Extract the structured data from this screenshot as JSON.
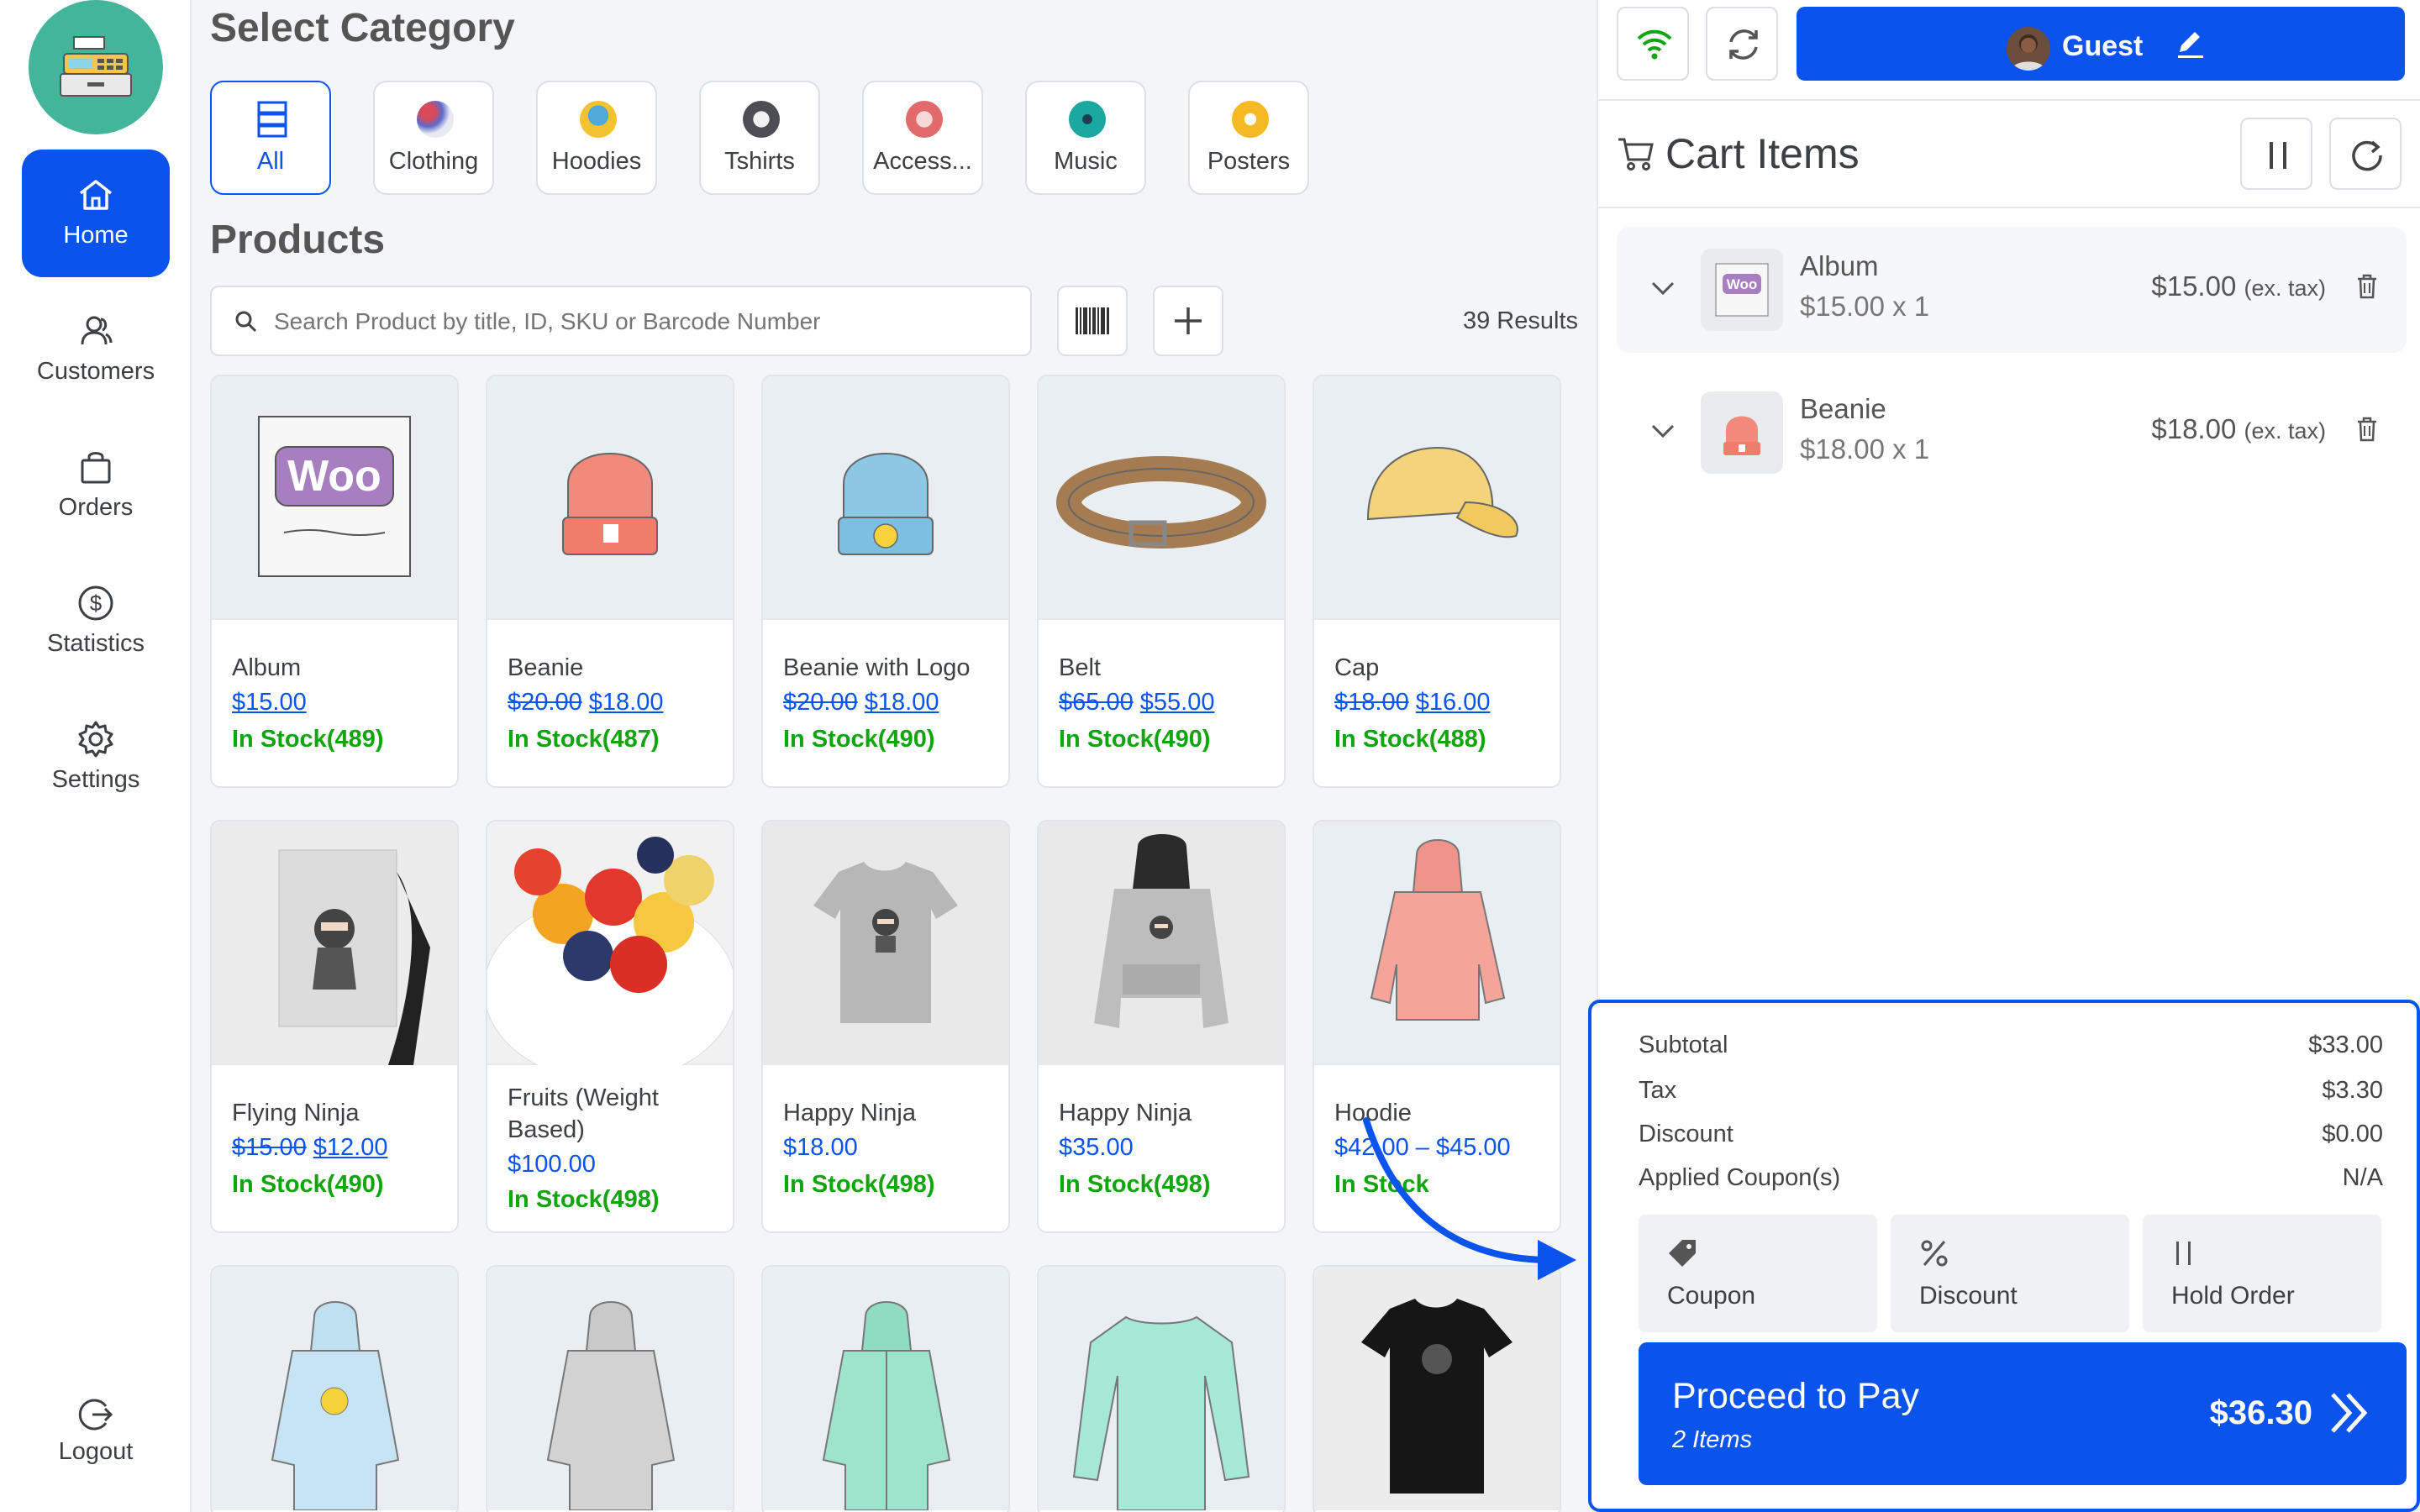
{
  "nav": {
    "items": [
      {
        "label": "Home",
        "icon": "home-icon",
        "active": true
      },
      {
        "label": "Customers",
        "icon": "customers-icon"
      },
      {
        "label": "Orders",
        "icon": "orders-icon"
      },
      {
        "label": "Statistics",
        "icon": "dollar-icon"
      },
      {
        "label": "Settings",
        "icon": "gear-icon"
      }
    ],
    "logout": "Logout"
  },
  "categories": {
    "title": "Select Category",
    "items": [
      {
        "label": "All",
        "active": true
      },
      {
        "label": "Clothing"
      },
      {
        "label": "Hoodies"
      },
      {
        "label": "Tshirts"
      },
      {
        "label": "Access..."
      },
      {
        "label": "Music"
      },
      {
        "label": "Posters"
      }
    ]
  },
  "products": {
    "title": "Products",
    "search_placeholder": "Search Product by title, ID, SKU or Barcode Number",
    "results": "39 Results",
    "items": [
      {
        "name": "Album",
        "price": "$15.00",
        "old_price": "",
        "stock": "In Stock(489)"
      },
      {
        "name": "Beanie",
        "price": "$18.00",
        "old_price": "$20.00",
        "stock": "In Stock(487)"
      },
      {
        "name": "Beanie with Logo",
        "price": "$18.00",
        "old_price": "$20.00",
        "stock": "In Stock(490)"
      },
      {
        "name": "Belt",
        "price": "$55.00",
        "old_price": "$65.00",
        "stock": "In Stock(490)"
      },
      {
        "name": "Cap",
        "price": "$16.00",
        "old_price": "$18.00",
        "stock": "In Stock(488)"
      },
      {
        "name": "Flying Ninja",
        "price": "$12.00",
        "old_price": "$15.00",
        "stock": "In Stock(490)"
      },
      {
        "name": "Fruits (Weight Based)",
        "price": "$100.00",
        "old_price": "",
        "stock": "In Stock(498)"
      },
      {
        "name": "Happy Ninja",
        "price": "$18.00",
        "old_price": "",
        "stock": "In Stock(498)"
      },
      {
        "name": "Happy Ninja",
        "price": "$35.00",
        "old_price": "",
        "stock": "In Stock(498)"
      },
      {
        "name": "Hoodie",
        "price": "$42.00 – $45.00",
        "old_price": "",
        "stock": "In Stock"
      }
    ]
  },
  "header": {
    "guest": "Guest"
  },
  "cart": {
    "title": "Cart Items",
    "items": [
      {
        "name": "Album",
        "qty_line": "$15.00 x 1",
        "total": "$15.00",
        "tax_note": "(ex. tax)"
      },
      {
        "name": "Beanie",
        "qty_line": "$18.00 x 1",
        "total": "$18.00",
        "tax_note": "(ex. tax)"
      }
    ],
    "summary": {
      "subtotal_label": "Subtotal",
      "subtotal": "$33.00",
      "tax_label": "Tax",
      "tax": "$3.30",
      "discount_label": "Discount",
      "discount": "$0.00",
      "coupons_label": "Applied Coupon(s)",
      "coupons": "N/A"
    },
    "actions": {
      "coupon": "Coupon",
      "discount": "Discount",
      "hold": "Hold Order"
    },
    "pay": {
      "label": "Proceed to Pay",
      "items": "2 Items",
      "amount": "$36.30"
    }
  },
  "colors": {
    "accent": "#0a53ec",
    "stock": "#11a60f",
    "logo": "#43b59a"
  }
}
